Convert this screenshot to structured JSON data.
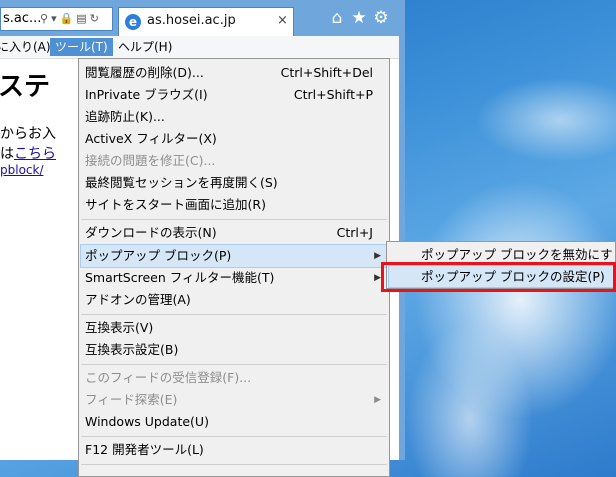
{
  "address_bar": {
    "text": "s.ac...",
    "icons": [
      "search-icon",
      "dropdown-icon",
      "lock-icon",
      "compat-icon",
      "refresh-icon"
    ]
  },
  "tab": {
    "title": "as.hosei.ac.jp",
    "close": "×"
  },
  "toolbar": {
    "home": "⌂",
    "favorites": "★",
    "tools": "⚙"
  },
  "menubar": {
    "items": [
      {
        "label": "に入り(A)"
      },
      {
        "label": "ツール(T)"
      },
      {
        "label": "ヘルプ(H)"
      }
    ]
  },
  "page": {
    "heading": "ステ",
    "line1": "からお入",
    "line2_prefix": "は",
    "line2_link": "こちら",
    "line3": "pblock/"
  },
  "tools_menu": {
    "items": [
      {
        "label": "閲覧履歴の削除(D)...",
        "shortcut": "Ctrl+Shift+Del"
      },
      {
        "label": "InPrivate ブラウズ(I)",
        "shortcut": "Ctrl+Shift+P"
      },
      {
        "label": "追跡防止(K)..."
      },
      {
        "label": "ActiveX フィルター(X)"
      },
      {
        "label": "接続の問題を修正(C)...",
        "disabled": true
      },
      {
        "label": "最終閲覧セッションを再度開く(S)"
      },
      {
        "label": "サイトをスタート画面に追加(R)"
      },
      {
        "label": "ダウンロードの表示(N)",
        "shortcut": "Ctrl+J"
      },
      {
        "label": "ポップアップ ブロック(P)"
      },
      {
        "label": "SmartScreen フィルター機能(T)"
      },
      {
        "label": "アドオンの管理(A)"
      },
      {
        "label": "互換表示(V)"
      },
      {
        "label": "互換表示設定(B)"
      },
      {
        "label": "このフィードの受信登録(F)...",
        "disabled": true
      },
      {
        "label": "フィード探索(E)",
        "disabled": true
      },
      {
        "label": "Windows Update(U)"
      },
      {
        "label": "F12 開発者ツール(L)"
      }
    ]
  },
  "popup_submenu": {
    "items": [
      {
        "label": "ポップアップ ブロックを無効にする(B)"
      },
      {
        "label": "ポップアップ ブロックの設定(P)"
      }
    ]
  },
  "colors": {
    "highlight": "#d5e6f7",
    "annotation_box": "#e8131b",
    "frame": "#6fa7dc"
  }
}
